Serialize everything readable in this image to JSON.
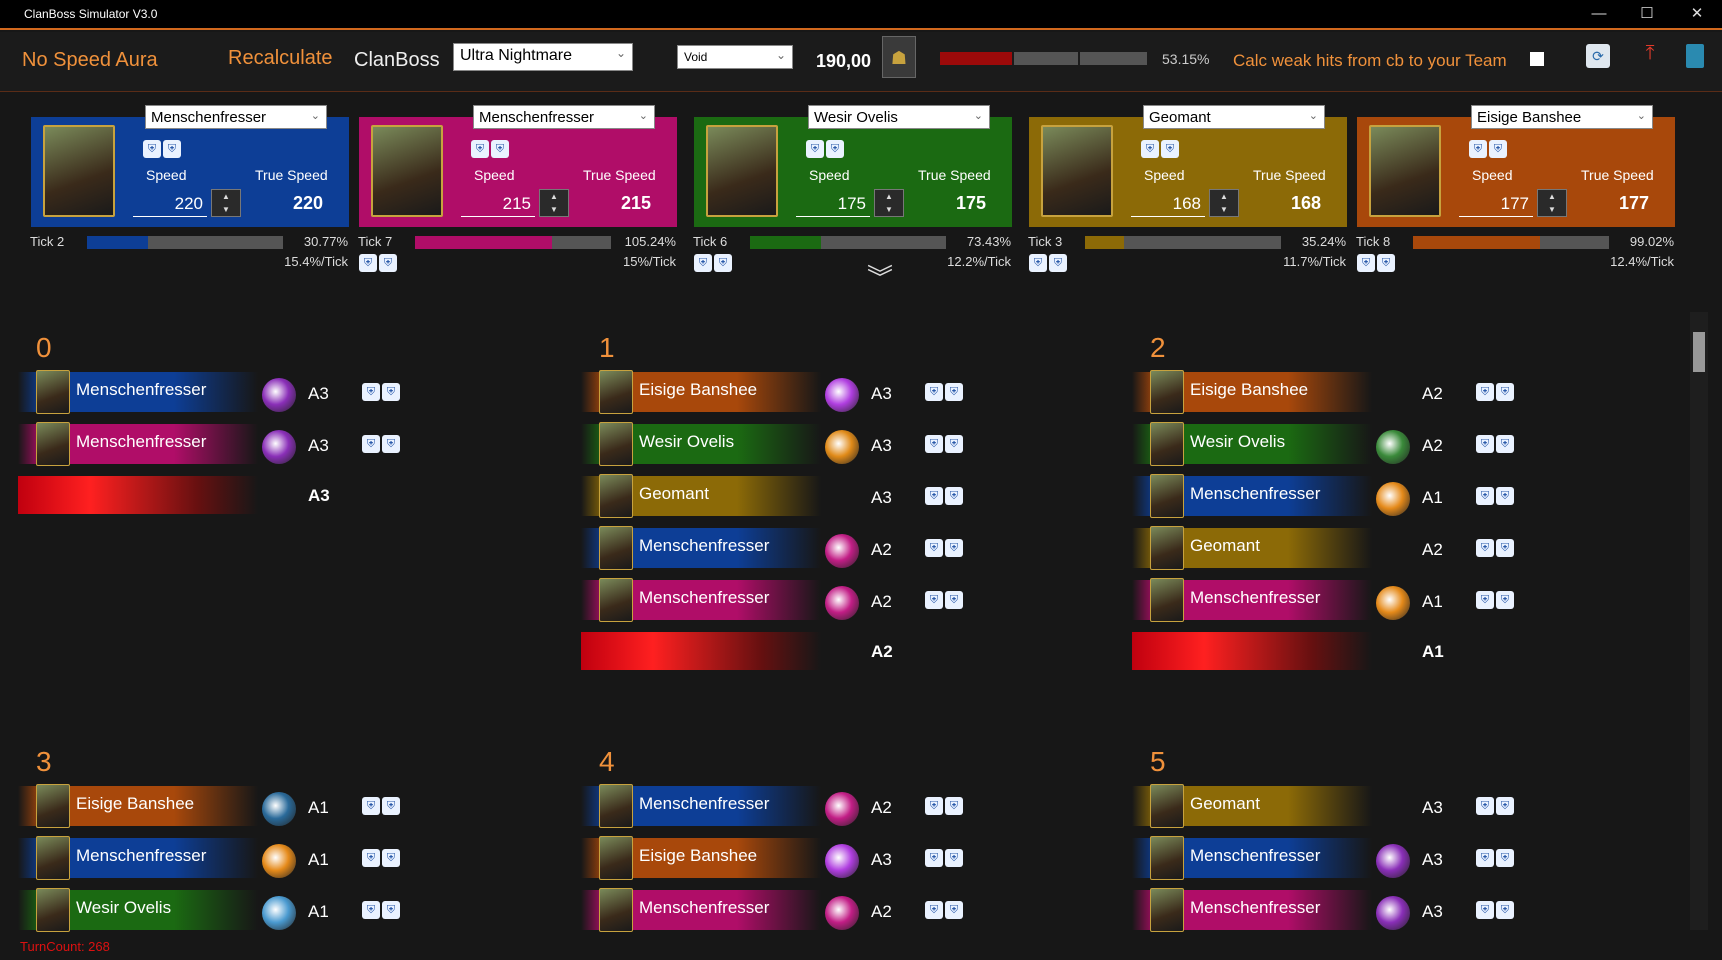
{
  "window": {
    "title": "ClanBoss Simulator V3.0",
    "min": "—",
    "max": "☐",
    "close": "✕"
  },
  "toolbar": {
    "aura": "No Speed Aura",
    "recalc": "Recalculate",
    "clanboss_label": "ClanBoss",
    "difficulty": "Ultra Nightmare",
    "affinity": "Void",
    "boss_speed": "190,00",
    "percent": "53.15%",
    "weak_hits": "Calc weak hits from cb to your Team"
  },
  "cards": [
    {
      "name": "Menschenfresser",
      "speed_label": "Speed",
      "true_label": "True Speed",
      "speed": "220",
      "true": "220",
      "tick": "Tick 2",
      "pct": "30.77%",
      "per_tick": "15.4%/Tick",
      "progress": 0.3077,
      "color": "#0d3e96"
    },
    {
      "name": "Menschenfresser",
      "speed_label": "Speed",
      "true_label": "True Speed",
      "speed": "215",
      "true": "215",
      "tick": "Tick 7",
      "pct": "105.24%",
      "per_tick": "15%/Tick",
      "progress": 0.7,
      "color": "#b00d68"
    },
    {
      "name": "Wesir Ovelis",
      "speed_label": "Speed",
      "true_label": "True Speed",
      "speed": "175",
      "true": "175",
      "tick": "Tick 6",
      "pct": "73.43%",
      "per_tick": "12.2%/Tick",
      "progress": 0.36,
      "color": "#1b6a12"
    },
    {
      "name": "Geomant",
      "speed_label": "Speed",
      "true_label": "True Speed",
      "speed": "168",
      "true": "168",
      "tick": "Tick 3",
      "pct": "35.24%",
      "per_tick": "11.7%/Tick",
      "progress": 0.2,
      "color": "#8c6a07"
    },
    {
      "name": "Eisige Banshee",
      "speed_label": "Speed",
      "true_label": "True Speed",
      "speed": "177",
      "true": "177",
      "tick": "Tick 8",
      "pct": "99.02%",
      "per_tick": "12.4%/Tick",
      "progress": 0.65,
      "color": "#a8480b"
    }
  ],
  "turns": [
    {
      "num": "0",
      "rows": [
        {
          "name": "Menschenfresser",
          "color": "#0d3e96",
          "ab": "#8a2fb8",
          "skill": "A3"
        },
        {
          "name": "Menschenfresser",
          "color": "#b00d68",
          "ab": "#8a2fb8",
          "skill": "A3"
        }
      ],
      "boss": "A3"
    },
    {
      "num": "1",
      "rows": [
        {
          "name": "Eisige Banshee",
          "color": "#a8480b",
          "ab": "#b03ee0",
          "skill": "A3"
        },
        {
          "name": "Wesir Ovelis",
          "color": "#1b6a12",
          "ab": "#e08a18",
          "skill": "A3"
        },
        {
          "name": "Geomant",
          "color": "#8c6a07",
          "ab": "",
          "skill": "A3"
        },
        {
          "name": "Menschenfresser",
          "color": "#0d3e96",
          "ab": "#c21e86",
          "skill": "A2"
        },
        {
          "name": "Menschenfresser",
          "color": "#b00d68",
          "ab": "#c21e86",
          "skill": "A2"
        }
      ],
      "boss": "A2"
    },
    {
      "num": "2",
      "rows": [
        {
          "name": "Eisige Banshee",
          "color": "#a8480b",
          "ab": "",
          "skill": "A2"
        },
        {
          "name": "Wesir Ovelis",
          "color": "#1b6a12",
          "ab": "#3a8a3a",
          "skill": "A2"
        },
        {
          "name": "Menschenfresser",
          "color": "#0d3e96",
          "ab": "#e58a1a",
          "skill": "A1"
        },
        {
          "name": "Geomant",
          "color": "#8c6a07",
          "ab": "",
          "skill": "A2"
        },
        {
          "name": "Menschenfresser",
          "color": "#b00d68",
          "ab": "#e58a1a",
          "skill": "A1"
        }
      ],
      "boss": "A1"
    },
    {
      "num": "3",
      "rows": [
        {
          "name": "Eisige Banshee",
          "color": "#a8480b",
          "ab": "#2a6a9a",
          "skill": "A1"
        },
        {
          "name": "Menschenfresser",
          "color": "#0d3e96",
          "ab": "#e58a1a",
          "skill": "A1"
        },
        {
          "name": "Wesir Ovelis",
          "color": "#1b6a12",
          "ab": "#4a9ad0",
          "skill": "A1"
        }
      ]
    },
    {
      "num": "4",
      "rows": [
        {
          "name": "Menschenfresser",
          "color": "#0d3e96",
          "ab": "#c21e86",
          "skill": "A2"
        },
        {
          "name": "Eisige Banshee",
          "color": "#a8480b",
          "ab": "#b03ee0",
          "skill": "A3"
        },
        {
          "name": "Menschenfresser",
          "color": "#b00d68",
          "ab": "#c21e86",
          "skill": "A2"
        }
      ]
    },
    {
      "num": "5",
      "rows": [
        {
          "name": "Geomant",
          "color": "#8c6a07",
          "ab": "",
          "skill": "A3"
        },
        {
          "name": "Menschenfresser",
          "color": "#0d3e96",
          "ab": "#8a2fb8",
          "skill": "A3"
        },
        {
          "name": "Menschenfresser",
          "color": "#b00d68",
          "ab": "#8a2fb8",
          "skill": "A3"
        }
      ]
    }
  ],
  "footer": {
    "turncount": "TurnCount: 268"
  }
}
